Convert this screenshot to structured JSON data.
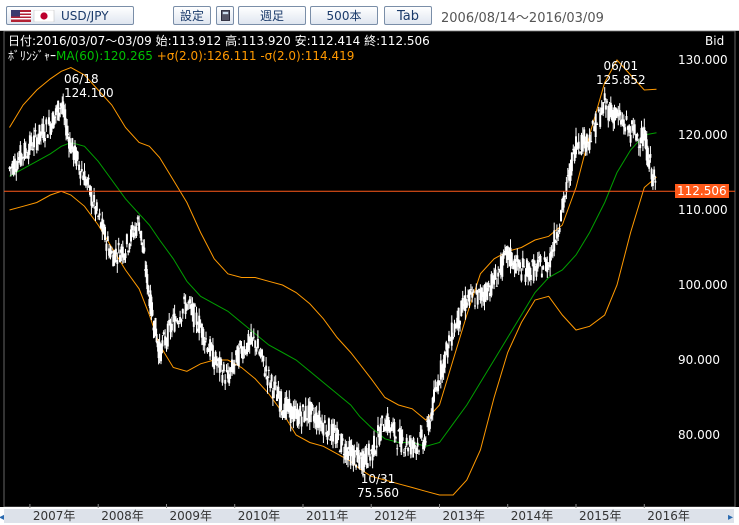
{
  "toolbar": {
    "pair_label": "USD/JPY",
    "settings_label": "設定",
    "period_label": "週足",
    "count_label": "500本",
    "tab_label": "Tab",
    "date_range": "2006/08/14～2016/03/09"
  },
  "info": {
    "date_line": "日付:2016/03/07～03/09",
    "open": "始:113.912",
    "high": "高:113.920",
    "low": "安:112.414",
    "close": "終:112.506",
    "boll_label": "ﾎﾞﾘﾝｼﾞｬｰ",
    "ma_text": "MA(60):120.265",
    "upper_text": "+σ(2.0):126.111",
    "lower_text": "-σ(2.0):114.419",
    "bid_label": "Bid"
  },
  "annotations": [
    {
      "date": "06/18",
      "value": "124.100"
    },
    {
      "date": "06/01",
      "value": "125.852"
    },
    {
      "date": "10/31",
      "value": "75.560"
    }
  ],
  "current_price_label": "112.506",
  "colors": {
    "candle": "#ffffff",
    "ma": "#00a000",
    "band": "#ff9900",
    "price_line": "#ff5a1a",
    "ma_text": "#00c000",
    "band_text": "#ff9900"
  },
  "chart_data": {
    "type": "line",
    "title": "",
    "ylim": [
      72,
      133
    ],
    "y_ticks": [
      "130.000",
      "120.000",
      "110.000",
      "100.000",
      "90.000",
      "80.000"
    ],
    "x_ticks": [
      "2007年",
      "2008年",
      "2009年",
      "2010年",
      "2011年",
      "2012年",
      "2013年",
      "2014年",
      "2015年",
      "2016年"
    ],
    "x": [
      2006.7,
      2006.9,
      2007.1,
      2007.3,
      2007.46,
      2007.6,
      2007.8,
      2008.0,
      2008.2,
      2008.4,
      2008.6,
      2008.75,
      2008.9,
      2009.1,
      2009.3,
      2009.5,
      2009.7,
      2009.9,
      2010.1,
      2010.3,
      2010.5,
      2010.7,
      2010.9,
      2011.1,
      2011.3,
      2011.5,
      2011.7,
      2011.83,
      2012.0,
      2012.2,
      2012.4,
      2012.6,
      2012.8,
      2013.0,
      2013.2,
      2013.4,
      2013.6,
      2013.8,
      2014.0,
      2014.2,
      2014.4,
      2014.6,
      2014.8,
      2015.0,
      2015.2,
      2015.42,
      2015.6,
      2015.8,
      2016.0,
      2016.18
    ],
    "series": [
      {
        "name": "USD/JPY",
        "values": [
          115.5,
          117.5,
          119.5,
          121.5,
          124.1,
          118.5,
          114.5,
          109,
          104,
          105,
          108.5,
          98.5,
          91,
          95,
          97.5,
          94.5,
          90,
          87.5,
          91.5,
          92.5,
          87.5,
          84,
          82.5,
          83,
          81.5,
          79.5,
          77.5,
          76.5,
          77.5,
          82,
          79.5,
          78.5,
          79.5,
          88,
          94,
          98,
          98.5,
          100.5,
          104,
          102,
          102,
          103,
          110,
          119,
          119.5,
          124,
          122.5,
          120.5,
          119.5,
          112.5
        ]
      },
      {
        "name": "MA(60)",
        "values": [
          114.5,
          115.5,
          116.5,
          117.5,
          118.5,
          119,
          118.5,
          116.5,
          114,
          111.5,
          109.5,
          108,
          106,
          103.5,
          100.5,
          98.5,
          97.5,
          96.5,
          95,
          93.5,
          92,
          91,
          90,
          88.5,
          87,
          85.5,
          84,
          82.5,
          81,
          79.5,
          79,
          79,
          78.5,
          79,
          81.5,
          84,
          87,
          90,
          93,
          96,
          99,
          101,
          102,
          104,
          107,
          111,
          115,
          118,
          120,
          120.3
        ]
      },
      {
        "name": "+σ(2.0)",
        "values": [
          121,
          124,
          126,
          127.5,
          128.5,
          129,
          128,
          126,
          124,
          121,
          119,
          118.5,
          117,
          114,
          111,
          107,
          103.5,
          101.5,
          101,
          101,
          100.5,
          100,
          99,
          97.5,
          95.5,
          93,
          91,
          89.5,
          87.5,
          85,
          84,
          83.5,
          82,
          84,
          90,
          96,
          101.5,
          103.5,
          104.5,
          105,
          106,
          106.5,
          108,
          113,
          120,
          127,
          130,
          128,
          126,
          126.1
        ]
      },
      {
        "name": "-σ(2.0)",
        "values": [
          110,
          110.5,
          111,
          112,
          112.5,
          112,
          110.5,
          108,
          105,
          102,
          99.5,
          96,
          92,
          89,
          88.5,
          89.5,
          90,
          90,
          89,
          87.5,
          85.5,
          83,
          80,
          79,
          78.5,
          77.5,
          76.5,
          75.5,
          74.5,
          74,
          73.5,
          73,
          72.5,
          72,
          72,
          74,
          78,
          85,
          91,
          95,
          98,
          98.5,
          96,
          94,
          94.5,
          96,
          100,
          107,
          113,
          114.4
        ]
      }
    ]
  }
}
